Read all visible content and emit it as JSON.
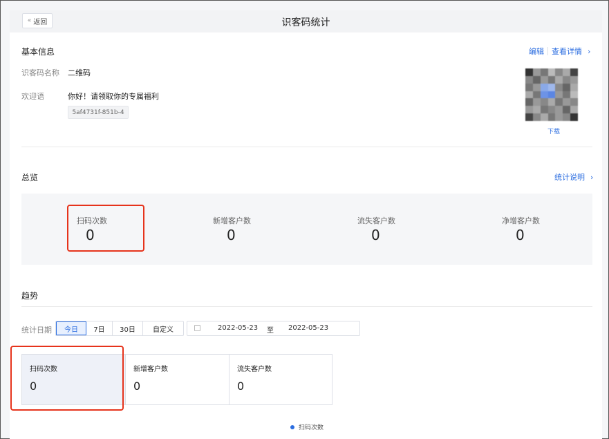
{
  "header": {
    "back_label": "返回",
    "title": "识客码统计"
  },
  "basic_info": {
    "title": "基本信息",
    "edit_label": "编辑",
    "details_label": "查看详情",
    "name_label": "识客码名称",
    "name_value": "二维码",
    "welcome_label": "欢迎语",
    "welcome_value": "你好！请领取你的专属福利",
    "attachment_chip": "5af4731f-851b-4",
    "download_label": "下载"
  },
  "overview": {
    "title": "总览",
    "stats_explain_label": "统计说明",
    "stats": [
      {
        "label": "扫码次数",
        "value": "0"
      },
      {
        "label": "新增客户数",
        "value": "0"
      },
      {
        "label": "流失客户数",
        "value": "0"
      },
      {
        "label": "净增客户数",
        "value": "0"
      }
    ]
  },
  "trend": {
    "title": "趋势",
    "date_label": "统计日期",
    "ranges": [
      "今日",
      "7日",
      "30日",
      "自定义"
    ],
    "active_range": "今日",
    "start_date": "2022-05-23",
    "to_label": "至",
    "end_date": "2022-05-23",
    "cards": [
      {
        "label": "扫码次数",
        "value": "0"
      },
      {
        "label": "新增客户数",
        "value": "0"
      },
      {
        "label": "流失客户数",
        "value": "0"
      }
    ],
    "legend": "扫码次数"
  },
  "colors": {
    "accent": "#2b6de0",
    "highlight": "#e6331b"
  },
  "icons": {
    "back": "double-chevron-left-icon",
    "calendar": "calendar-icon",
    "chevron": "chevron-right-icon"
  }
}
